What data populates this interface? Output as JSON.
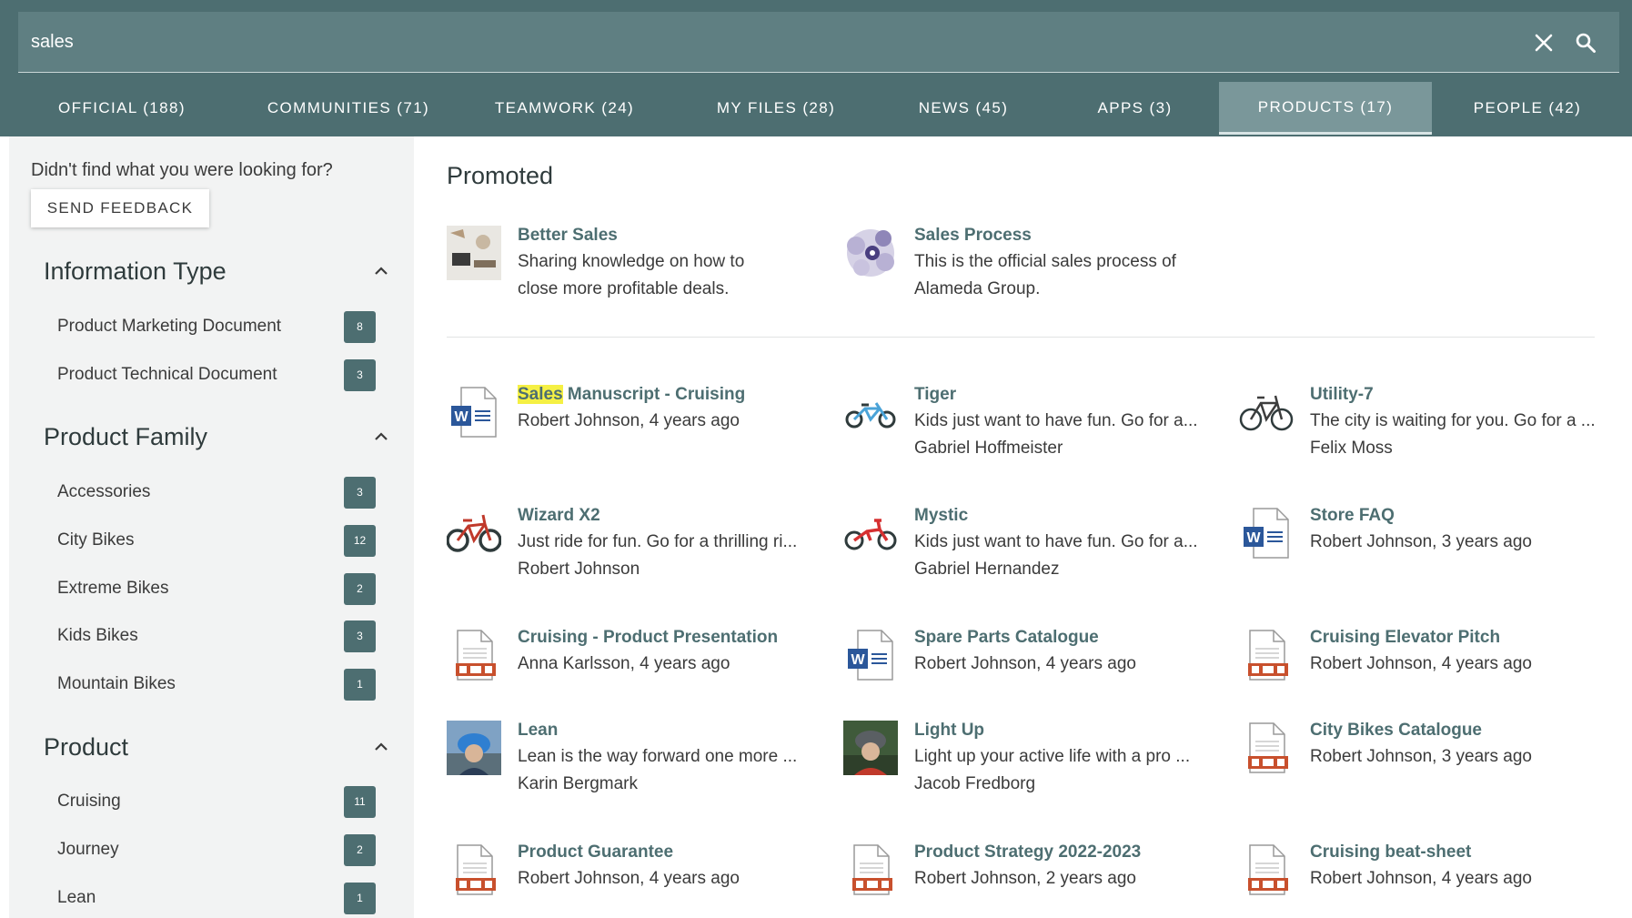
{
  "search": {
    "query": "sales",
    "clear_icon": "close-icon",
    "search_icon": "search-icon"
  },
  "tabs": [
    {
      "label": "OFFICIAL (188)",
      "active": false
    },
    {
      "label": "COMMUNITIES (71)",
      "active": false
    },
    {
      "label": "TEAMWORK (24)",
      "active": false
    },
    {
      "label": "MY FILES (28)",
      "active": false
    },
    {
      "label": "NEWS (45)",
      "active": false
    },
    {
      "label": "APPS (3)",
      "active": false
    },
    {
      "label": "PRODUCTS (17)",
      "active": true
    },
    {
      "label": "PEOPLE (42)",
      "active": false
    }
  ],
  "sidebar": {
    "feedback_prompt": "Didn't find what you were looking for?",
    "feedback_button": "SEND FEEDBACK",
    "facets": [
      {
        "title": "Information Type",
        "items": [
          {
            "label": "Product Marketing Document",
            "count": "8"
          },
          {
            "label": "Product Technical Document",
            "count": "3"
          }
        ]
      },
      {
        "title": "Product Family",
        "items": [
          {
            "label": "Accessories",
            "count": "3"
          },
          {
            "label": "City Bikes",
            "count": "12"
          },
          {
            "label": "Extreme Bikes",
            "count": "2"
          },
          {
            "label": "Kids Bikes",
            "count": "3"
          },
          {
            "label": "Mountain Bikes",
            "count": "1"
          }
        ]
      },
      {
        "title": "Product",
        "items": [
          {
            "label": "Cruising",
            "count": "11"
          },
          {
            "label": "Journey",
            "count": "2"
          },
          {
            "label": "Lean",
            "count": "1"
          }
        ]
      }
    ]
  },
  "main": {
    "promoted_title": "Promoted",
    "promoted": [
      {
        "title": "Better Sales",
        "line1": "Sharing knowledge on how to",
        "line2": "close more profitable deals.",
        "thumb": "photo-desk"
      },
      {
        "title": "Sales Process",
        "line1": "This is the official sales process of",
        "line2": "Alameda Group.",
        "thumb": "process-diagram"
      }
    ],
    "results": [
      {
        "title_highlight": "Sales",
        "title": " Manuscript - Cruising",
        "line1": "Robert Johnson, 4 years ago",
        "line2": "",
        "thumb": "word-doc"
      },
      {
        "title_highlight": "",
        "title": "Tiger",
        "line1": "Kids just want to have fun. Go for a...",
        "line2": "Gabriel Hoffmeister",
        "thumb": "bike-kids-blue"
      },
      {
        "title_highlight": "",
        "title": "Utility-7",
        "line1": "The city is waiting for you. Go for a ...",
        "line2": "Felix Moss",
        "thumb": "bike-city"
      },
      {
        "title_highlight": "",
        "title": "Wizard X2",
        "line1": "Just ride for fun. Go for a thrilling ri...",
        "line2": "Robert Johnson",
        "thumb": "bike-mountain"
      },
      {
        "title_highlight": "",
        "title": "Mystic",
        "line1": "Kids just want to have fun. Go for a...",
        "line2": "Gabriel Hernandez",
        "thumb": "bike-kids-red"
      },
      {
        "title_highlight": "",
        "title": "Store FAQ",
        "line1": "Robert Johnson, 3 years ago",
        "line2": "",
        "thumb": "word-doc"
      },
      {
        "title_highlight": "",
        "title": "Cruising - Product Presentation",
        "line1": "Anna Karlsson, 4 years ago",
        "line2": "",
        "thumb": "ppt-doc"
      },
      {
        "title_highlight": "",
        "title": "Spare Parts Catalogue",
        "line1": "Robert Johnson, 4 years ago",
        "line2": "",
        "thumb": "word-doc"
      },
      {
        "title_highlight": "",
        "title": "Cruising Elevator Pitch",
        "line1": "Robert Johnson, 4 years ago",
        "line2": "",
        "thumb": "ppt-doc"
      },
      {
        "title_highlight": "",
        "title": "Lean",
        "line1": "Lean is the way forward one more ...",
        "line2": "Karin Bergmark",
        "thumb": "photo-rider-blue"
      },
      {
        "title_highlight": "",
        "title": "Light Up",
        "line1": "Light up your active life with a pro ...",
        "line2": "Jacob Fredborg",
        "thumb": "photo-rider-red"
      },
      {
        "title_highlight": "",
        "title": "City Bikes Catalogue",
        "line1": "Robert Johnson, 3 years ago",
        "line2": "",
        "thumb": "ppt-doc"
      },
      {
        "title_highlight": "",
        "title": "Product Guarantee",
        "line1": "Robert Johnson, 4 years ago",
        "line2": "",
        "thumb": "ppt-doc"
      },
      {
        "title_highlight": "",
        "title": "Product Strategy 2022-2023",
        "line1": "Robert Johnson, 2 years ago",
        "line2": "",
        "thumb": "ppt-doc"
      },
      {
        "title_highlight": "",
        "title": "Cruising beat-sheet",
        "line1": "Robert Johnson, 4 years ago",
        "line2": "",
        "thumb": "ppt-doc"
      }
    ]
  },
  "colors": {
    "header": "#4d6e71",
    "accent": "#4d6e71",
    "highlight": "#f5f044",
    "word_blue": "#2b579a",
    "ppt_orange": "#c8502d"
  }
}
